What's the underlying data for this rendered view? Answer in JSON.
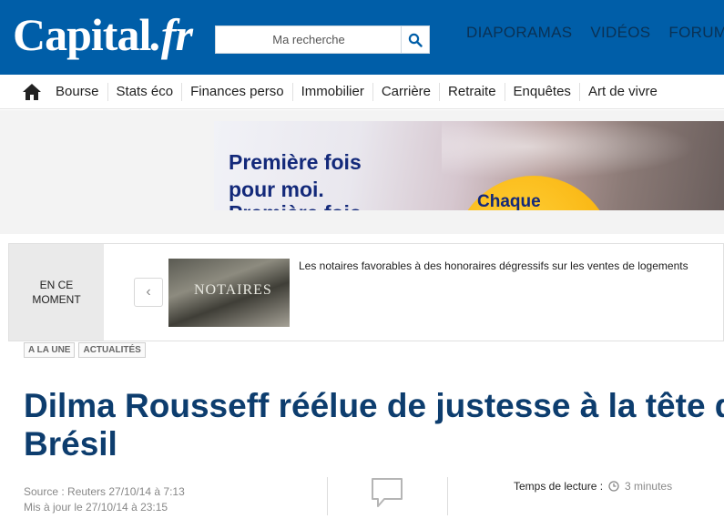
{
  "header": {
    "logo_main": "Capital",
    "logo_suffix": ".fr",
    "search_placeholder": "Ma recherche",
    "top_links": [
      "DIAPORAMAS",
      "VIDÉOS",
      "FORUM"
    ]
  },
  "nav": {
    "items": [
      "Bourse",
      "Stats éco",
      "Finances perso",
      "Immobilier",
      "Carrière",
      "Retraite",
      "Enquêtes",
      "Art de vivre"
    ]
  },
  "ad": {
    "line1": "Première fois",
    "line2": "pour moi.",
    "line3": "Première fois",
    "circle_text": "Chaque"
  },
  "ticker": {
    "label_line1": "EN CE",
    "label_line2": "MOMENT",
    "prev_symbol": "‹",
    "thumb_text": "NOTAIRES",
    "headline": "Les notaires favorables à des honoraires dégressifs sur les ventes de logements"
  },
  "article": {
    "tags": [
      "A LA UNE",
      "ACTUALITÉS"
    ],
    "title_line1": "Dilma Rousseff réélue de justesse à la tête du",
    "title_line2": "Brésil",
    "source": "Source : Reuters 27/10/14 à 7:13",
    "updated": "Mis à jour le 27/10/14 à 23:15",
    "reading_label": "Temps de lecture :",
    "reading_value": "3 minutes"
  },
  "colors": {
    "header_blue": "#005ea8",
    "title_blue": "#0d3d6e",
    "ad_yellow": "#f7a900"
  }
}
